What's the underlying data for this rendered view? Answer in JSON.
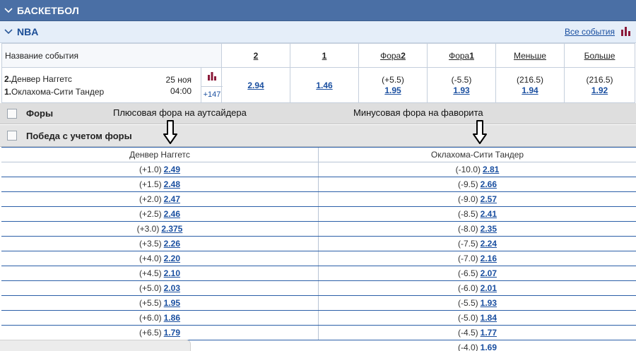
{
  "sport": {
    "title": "БАСКЕТБОЛ"
  },
  "league": {
    "title": "NBA",
    "all_events": "Все события"
  },
  "table": {
    "headers": {
      "name": "Название события",
      "c2": "2",
      "c1": "1",
      "fora2_label": "Фора",
      "fora2_num": "2",
      "fora1_label": "Фора",
      "fora1_num": "1",
      "less": "Меньше",
      "more": "Больше"
    },
    "event": {
      "team1_num": "2.",
      "team1": "Денвер Наггетс",
      "team2_num": "1.",
      "team2": "Оклахома-Сити Тандер",
      "date": "25 ноя",
      "time": "04:00",
      "more_bets": "+147",
      "odd_2": "2.94",
      "odd_1": "1.46",
      "fora2_hcp": "(+5.5)",
      "fora2_odd": "1.95",
      "fora1_hcp": "(-5.5)",
      "fora1_odd": "1.93",
      "less_total": "(216.5)",
      "less_odd": "1.94",
      "more_total": "(216.5)",
      "more_odd": "1.92"
    }
  },
  "groups": {
    "fory": "Форы",
    "win_hcp": "Победа с учетом форы",
    "note_left": "Плюсовая фора на аутсайдера",
    "note_right": "Минусовая фора на фаворита"
  },
  "handicap": {
    "team_left": "Денвер Наггетс",
    "team_right": "Оклахома-Сити Тандер",
    "rows": [
      {
        "lh": "(+1.0)",
        "lo": "2.49",
        "rh": "(-10.0)",
        "ro": "2.81"
      },
      {
        "lh": "(+1.5)",
        "lo": "2.48",
        "rh": "(-9.5)",
        "ro": "2.66"
      },
      {
        "lh": "(+2.0)",
        "lo": "2.47",
        "rh": "(-9.0)",
        "ro": "2.57"
      },
      {
        "lh": "(+2.5)",
        "lo": "2.46",
        "rh": "(-8.5)",
        "ro": "2.41"
      },
      {
        "lh": "(+3.0)",
        "lo": "2.375",
        "rh": "(-8.0)",
        "ro": "2.35"
      },
      {
        "lh": "(+3.5)",
        "lo": "2.26",
        "rh": "(-7.5)",
        "ro": "2.24"
      },
      {
        "lh": "(+4.0)",
        "lo": "2.20",
        "rh": "(-7.0)",
        "ro": "2.16"
      },
      {
        "lh": "(+4.5)",
        "lo": "2.10",
        "rh": "(-6.5)",
        "ro": "2.07"
      },
      {
        "lh": "(+5.0)",
        "lo": "2.03",
        "rh": "(-6.0)",
        "ro": "2.01"
      },
      {
        "lh": "(+5.5)",
        "lo": "1.95",
        "rh": "(-5.5)",
        "ro": "1.93"
      },
      {
        "lh": "(+6.0)",
        "lo": "1.86",
        "rh": "(-5.0)",
        "ro": "1.84"
      },
      {
        "lh": "(+6.5)",
        "lo": "1.79",
        "rh": "(-4.5)",
        "ro": "1.77"
      },
      {
        "lh": "",
        "lo": "",
        "rh": "(-4.0)",
        "ro": "1.69"
      }
    ]
  },
  "icons": {
    "chevron": "chevron-down-icon",
    "stats": "bar-chart-icon",
    "arrow": "arrow-down-icon"
  },
  "colors": {
    "sport_header": "#4a6fa5",
    "league_header": "#e5eef9",
    "link": "#1a4fa0",
    "stats_icon": "#8b1a3a"
  }
}
